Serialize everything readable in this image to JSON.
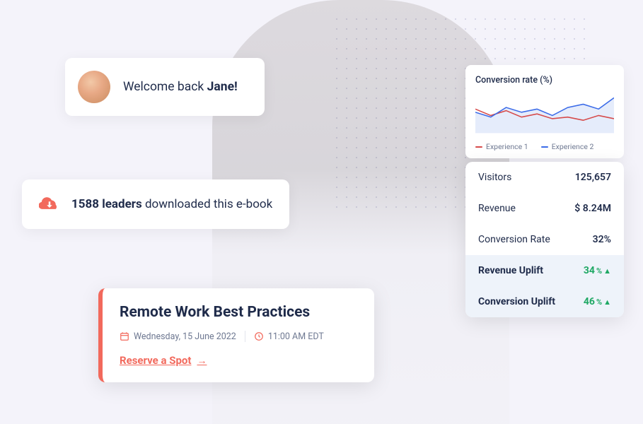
{
  "welcome": {
    "greeting_prefix": "Welcome back ",
    "user_name": "Jane!"
  },
  "download": {
    "bold_part": "1588 leaders",
    "rest": " downloaded this e-book"
  },
  "event": {
    "title": "Remote Work Best Practices",
    "date": "Wednesday, 15 June 2022",
    "time": "11:00 AM EDT",
    "cta": "Reserve a Spot"
  },
  "chart": {
    "title": "Conversion rate (%)",
    "legend": {
      "s1": "Experience 1",
      "s2": "Experience 2"
    },
    "colors": {
      "s1": "#D64A4A",
      "s2": "#3B6BE8"
    }
  },
  "chart_data": {
    "type": "line",
    "title": "Conversion rate (%)",
    "xlabel": "",
    "ylabel": "",
    "x": [
      0,
      1,
      2,
      3,
      4,
      5,
      6,
      7,
      8,
      9
    ],
    "series": [
      {
        "name": "Experience 1",
        "color": "#D64A4A",
        "values": [
          30,
          22,
          28,
          20,
          24,
          18,
          20,
          16,
          22,
          18
        ]
      },
      {
        "name": "Experience 2",
        "color": "#3B6BE8",
        "values": [
          26,
          20,
          32,
          26,
          30,
          22,
          32,
          36,
          30,
          44
        ]
      }
    ],
    "ylim": [
      0,
      50
    ]
  },
  "stats": {
    "rows": [
      {
        "label": "Visitors",
        "value": "125,657"
      },
      {
        "label": "Revenue",
        "value": "$ 8.24M"
      },
      {
        "label": "Conversion Rate",
        "value": "32%"
      }
    ],
    "highlight": [
      {
        "label": "Revenue Uplift",
        "value": "34",
        "suffix": "%"
      },
      {
        "label": "Conversion Uplift",
        "value": "46",
        "suffix": "%"
      }
    ]
  }
}
